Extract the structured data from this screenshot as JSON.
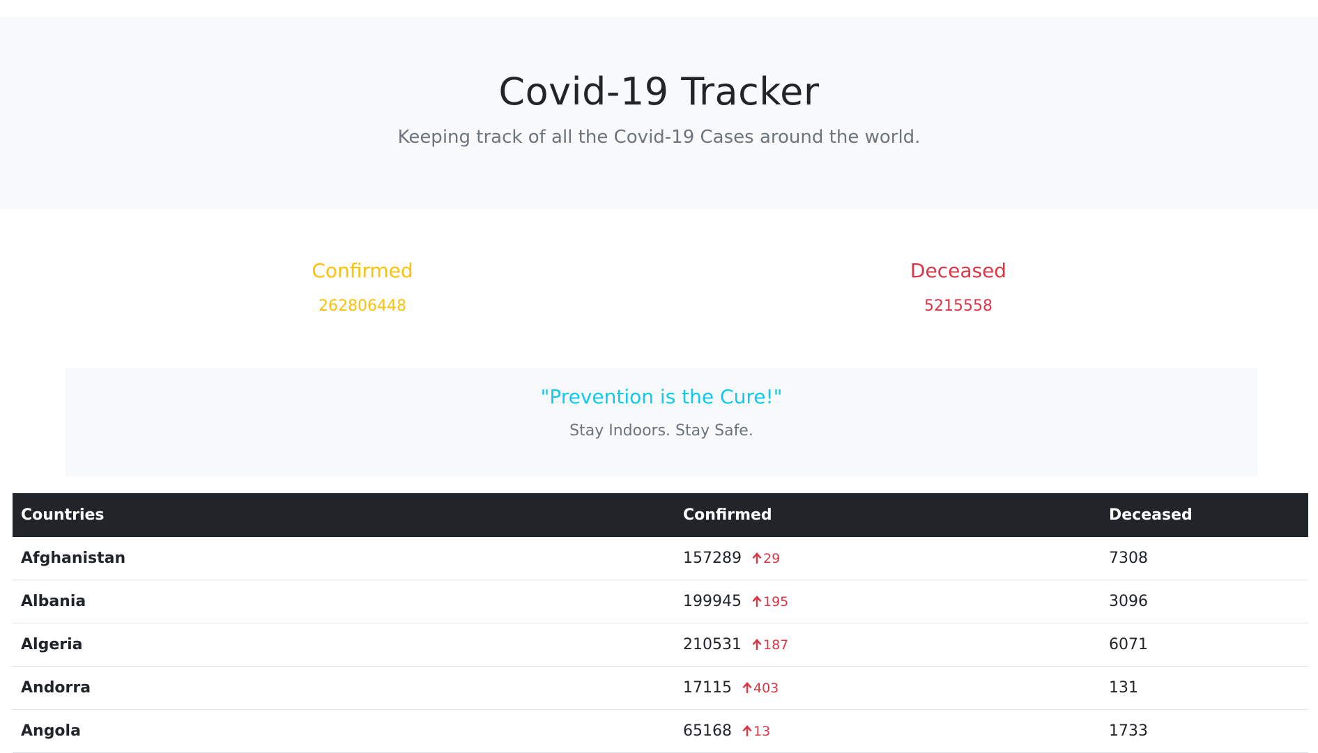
{
  "header": {
    "title": "Covid-19 Tracker",
    "subtitle": "Keeping track of all the Covid-19 Cases around the world."
  },
  "stats": {
    "confirmed_label": "Confirmed",
    "confirmed_value": "262806448",
    "deceased_label": "Deceased",
    "deceased_value": "5215558"
  },
  "colors": {
    "confirmed": "#ffc107",
    "deceased": "#dc3545",
    "quote": "#0dcaf0",
    "table_header_bg": "#212529"
  },
  "banner": {
    "quote": "\"Prevention is the Cure!\"",
    "message": "Stay Indoors. Stay Safe."
  },
  "table": {
    "headers": {
      "country": "Countries",
      "confirmed": "Confirmed",
      "deceased": "Deceased"
    },
    "delta_icon": "arrow-up-icon",
    "rows": [
      {
        "country": "Afghanistan",
        "confirmed": "157289",
        "new": "29",
        "deceased": "7308"
      },
      {
        "country": "Albania",
        "confirmed": "199945",
        "new": "195",
        "deceased": "3096"
      },
      {
        "country": "Algeria",
        "confirmed": "210531",
        "new": "187",
        "deceased": "6071"
      },
      {
        "country": "Andorra",
        "confirmed": "17115",
        "new": "403",
        "deceased": "131"
      },
      {
        "country": "Angola",
        "confirmed": "65168",
        "new": "13",
        "deceased": "1733"
      }
    ]
  }
}
